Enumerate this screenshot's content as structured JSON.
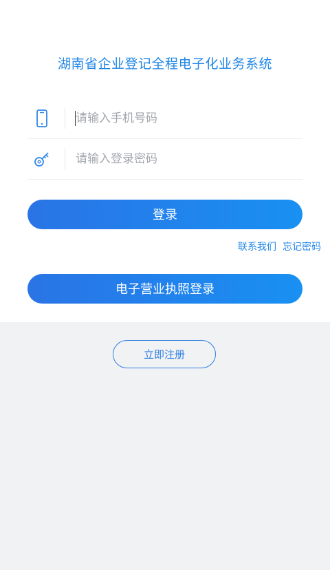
{
  "app": {
    "title": "湖南省企业登记全程电子化业务系统"
  },
  "form": {
    "phone_placeholder": "请输入手机号码",
    "password_placeholder": "请输入登录密码",
    "phone_icon": "mobile-phone-icon",
    "password_icon": "key-icon"
  },
  "actions": {
    "login_label": "登录",
    "contact_label": "联系我们",
    "forgot_label": "忘记密码",
    "license_login_label": "电子营业执照登录",
    "register_label": "立即注册"
  },
  "colors": {
    "accent": "#1f86e6",
    "button_gradient_start": "#2a74e6",
    "button_gradient_end": "#1990f2",
    "page_background": "#f1f2f4"
  }
}
